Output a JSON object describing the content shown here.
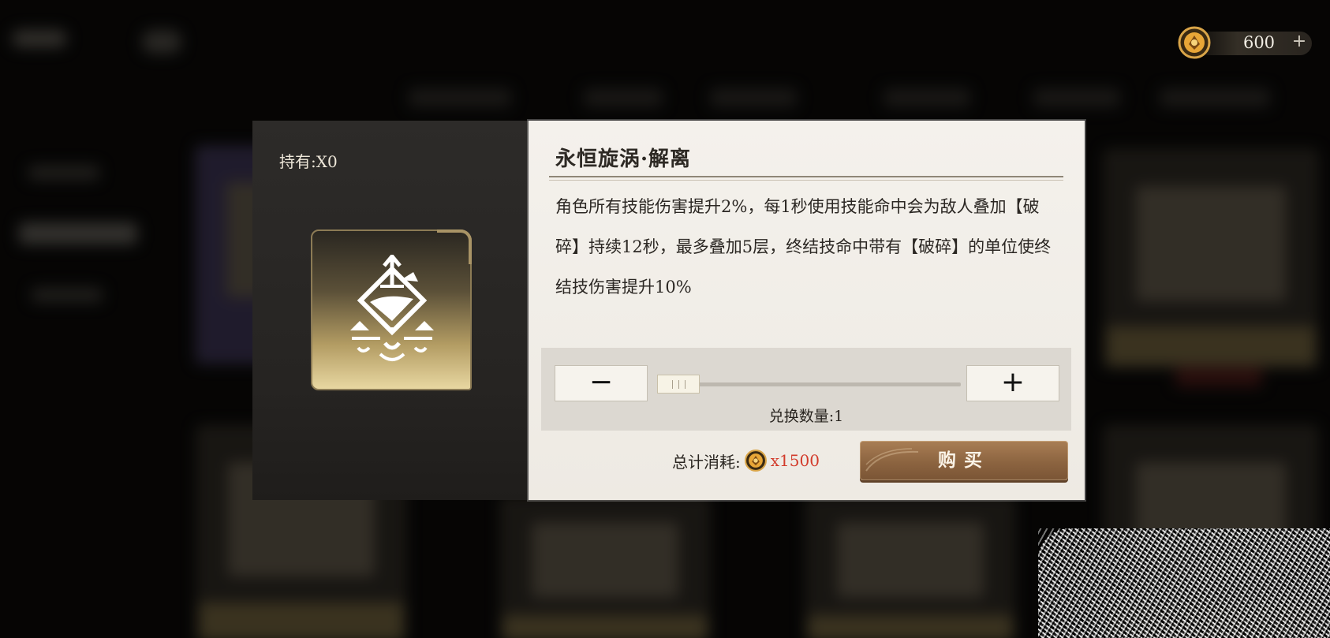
{
  "currency": {
    "amount": "600",
    "plus_symbol": "+",
    "icon": "coin-icon"
  },
  "item": {
    "owned_label": "持有:X0",
    "icon": "rune-sigil-icon",
    "title": "永恒旋涡·解离",
    "description": "角色所有技能伤害提升2%，每1秒使用技能命中会为敌人叠加【破碎】持续12秒，最多叠加5层，终结技命中带有【破碎】的单位使终结技伤害提升10%"
  },
  "quantity": {
    "minus_symbol": "−",
    "plus_symbol": "+",
    "label": "兑换数量:1",
    "value": 1,
    "slider_fraction": 0.0
  },
  "purchase": {
    "total_label": "总计消耗:",
    "cost": "x1500",
    "buy_label": "购买"
  },
  "colors": {
    "cost_red": "#d23b2b",
    "buy_brown": "#8c6440",
    "panel_light": "#f4f1ec",
    "panel_dark": "#2d2b29"
  }
}
